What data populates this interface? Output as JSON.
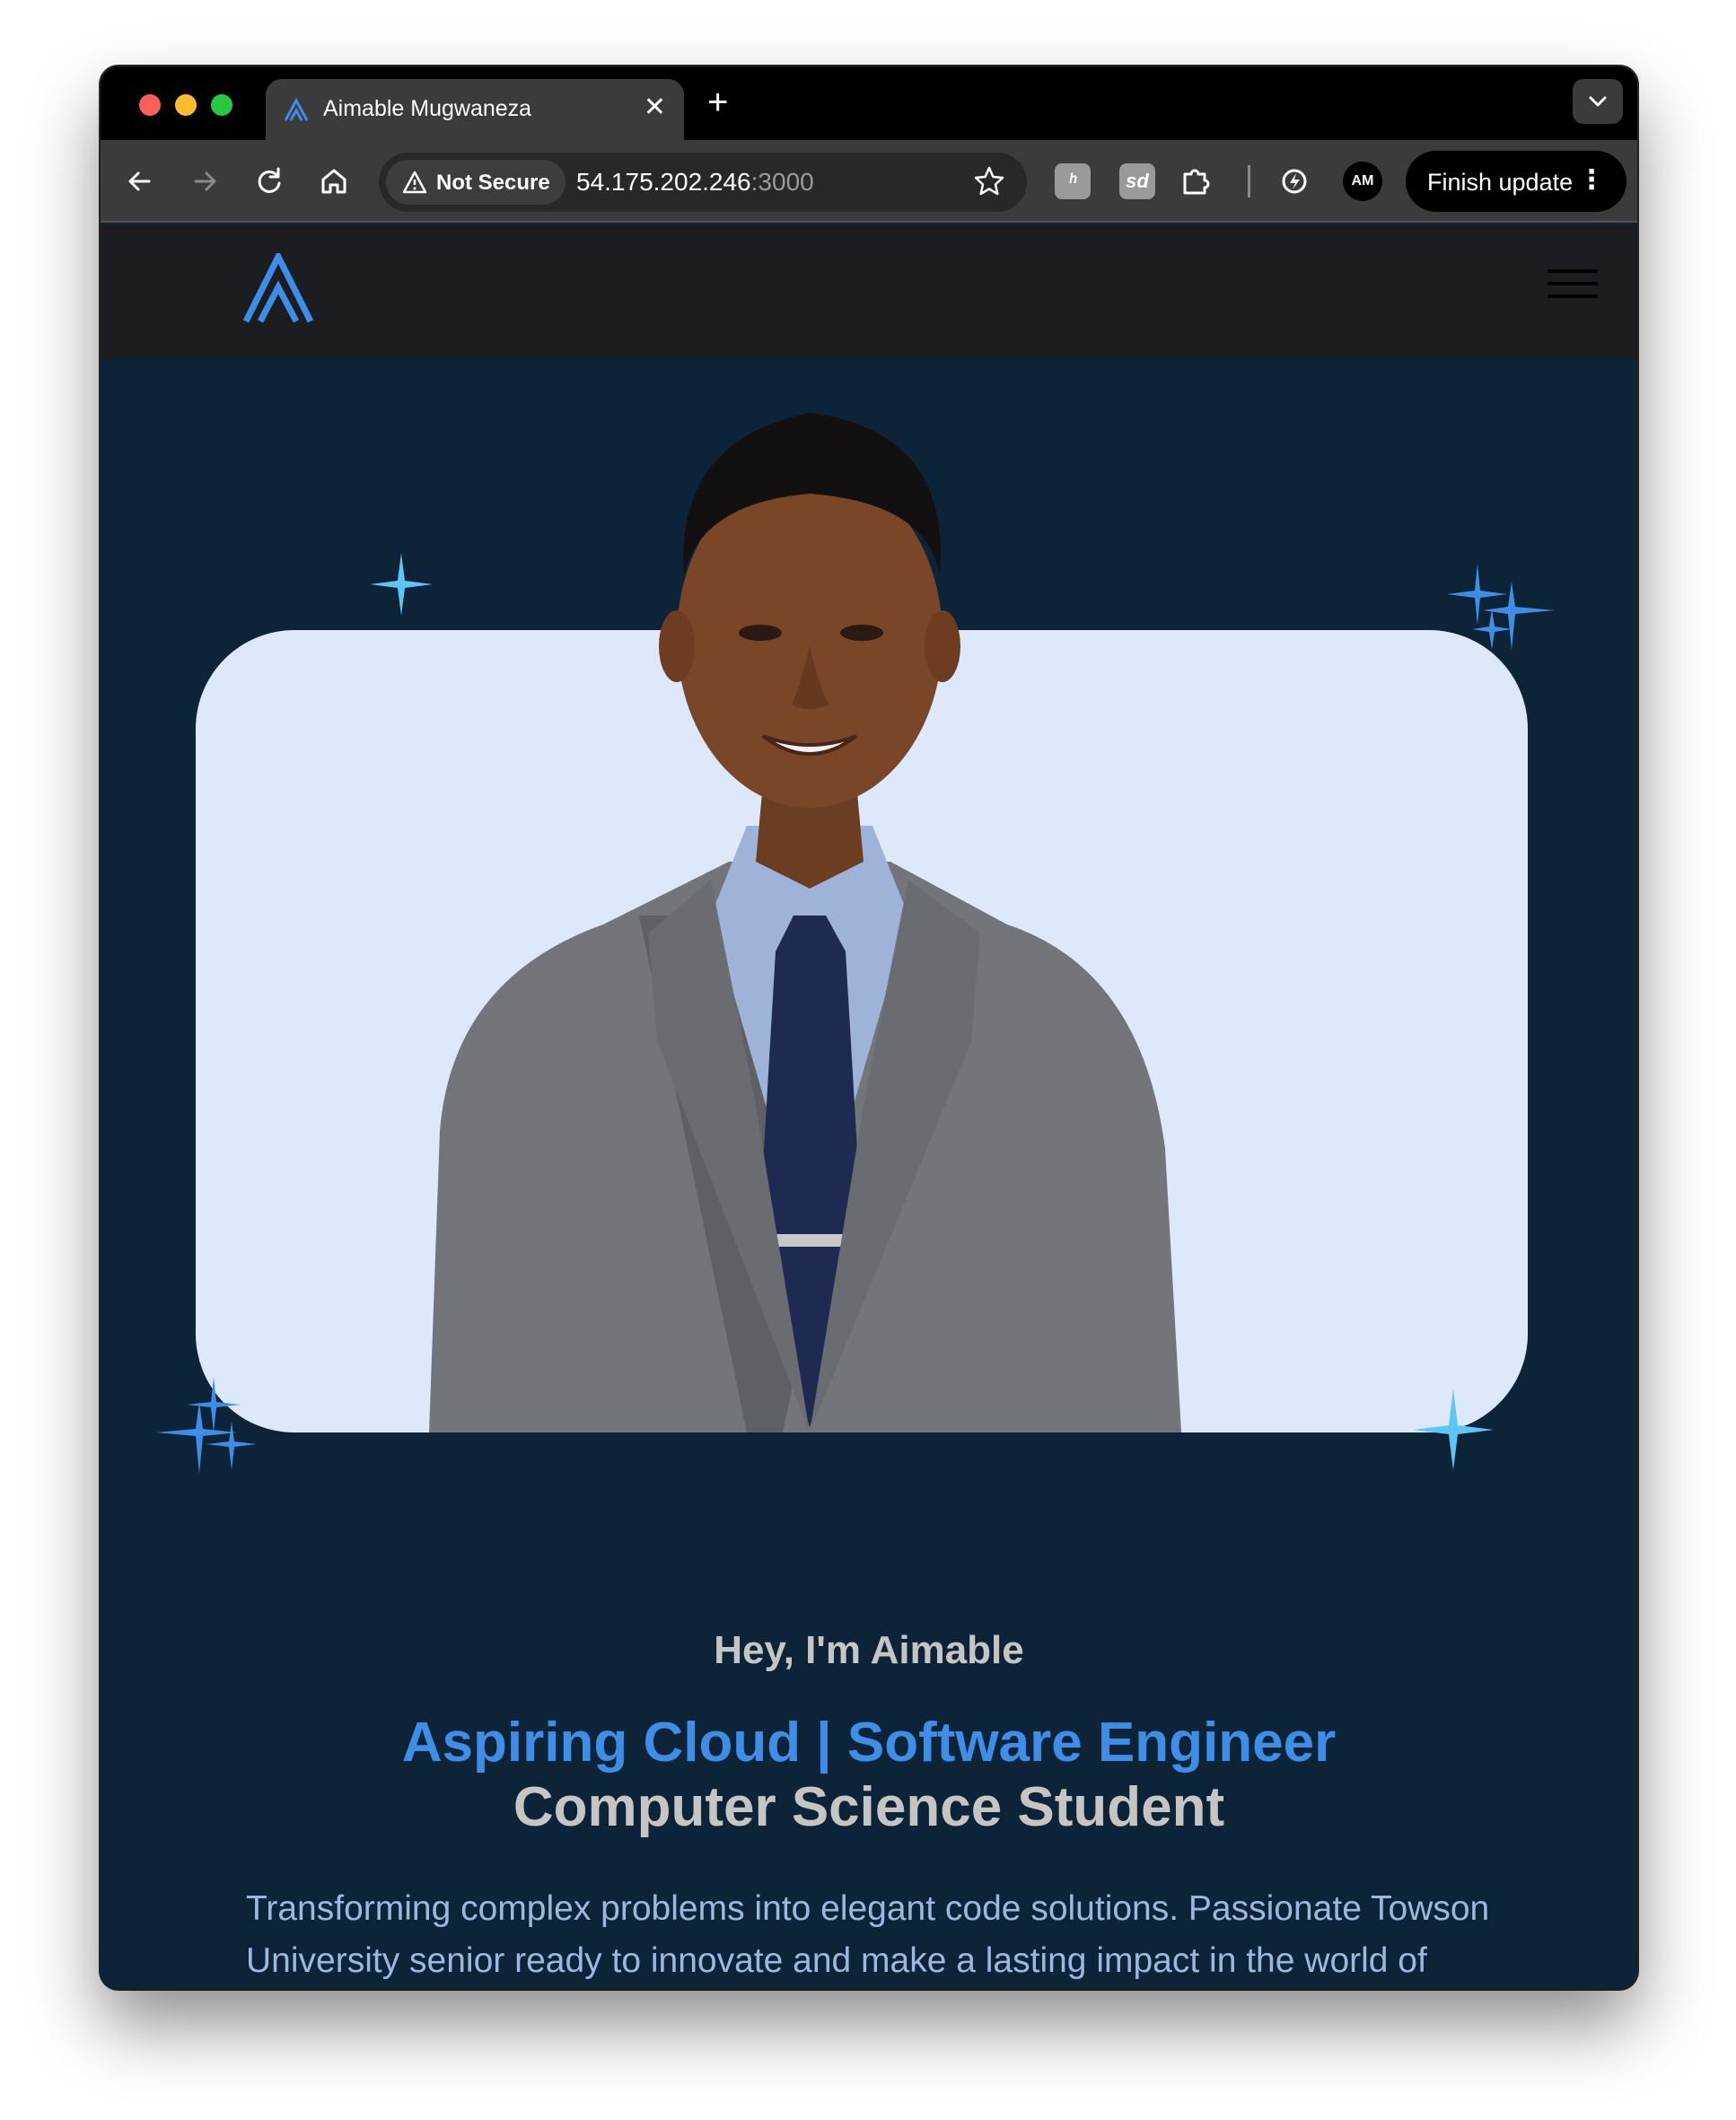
{
  "browser": {
    "tab": {
      "title": "Aimable Mugwaneza",
      "close": "✕"
    },
    "new_tab": "+",
    "security_chip": "Not Secure",
    "url_host": "54.175.202.246",
    "url_port": ":3000",
    "extensions": [
      "ʰ",
      "sd"
    ],
    "profile_initials": "AM",
    "update_button": "Finish update",
    "update_menu": "⋮",
    "icons": [
      "back-arrow-icon",
      "forward-arrow-icon",
      "reload-icon",
      "home-icon",
      "warning-icon",
      "star-icon",
      "puzzle-icon",
      "bolt-icon",
      "chevron-down-icon"
    ]
  },
  "site": {
    "greeting": "Hey, I'm Aimable",
    "role": "Aspiring Cloud | Software Engineer",
    "subrole": "Computer Science Student",
    "description": "Transforming complex problems into elegant code solutions. Passionate Towson University senior ready to innovate and make a lasting impact in the world of software engineering."
  },
  "colors": {
    "brand_blue": "#3e8ee8",
    "hero_bg": "#0d2438",
    "card_bg": "#dde9fb",
    "navbar_bg": "#1b1d20",
    "sparkle": "#5ec6f2"
  }
}
